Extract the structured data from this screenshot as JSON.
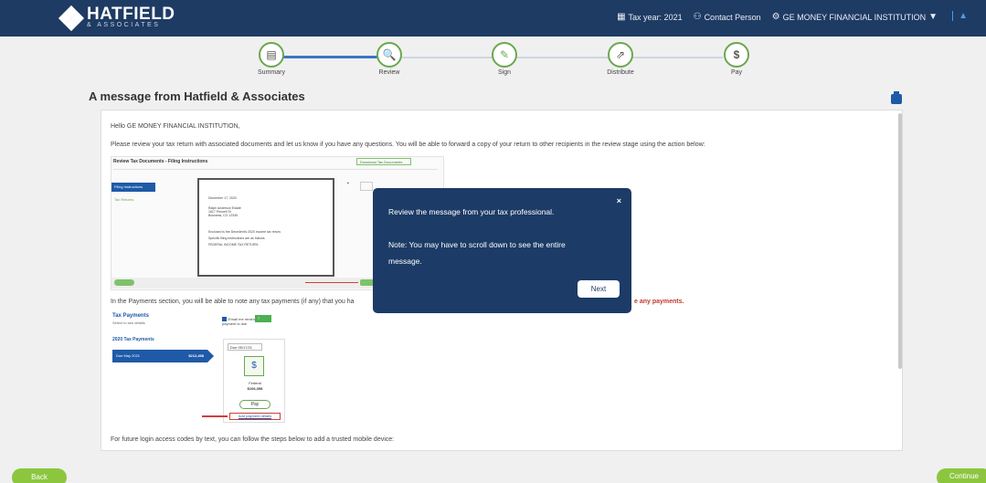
{
  "header": {
    "brand": "HATFIELD",
    "brand_sub": "& ASSOCIATES",
    "tax_year": "Tax year: 2021",
    "contact": "Contact Person",
    "client": "GE MONEY FINANCIAL INSTITUTION"
  },
  "stepper": {
    "steps": [
      {
        "label": "Summary",
        "icon": "document-icon"
      },
      {
        "label": "Review",
        "icon": "magnify-document-icon"
      },
      {
        "label": "Sign",
        "icon": "pen-icon"
      },
      {
        "label": "Distribute",
        "icon": "share-document-icon"
      },
      {
        "label": "Pay",
        "icon": "dollar-icon"
      }
    ]
  },
  "main": {
    "title": "A message from Hatfield & Associates",
    "greeting": "Hello GE MONEY FINANCIAL INSTITUTION,",
    "intro": "Please review your tax return with associated documents and let us know if you have any questions. You will be able to forward a copy of your return to other recipients in the review stage using the action below:",
    "payments_text": "In the Payments section, you will be able to note any tax payments (if any) that you ha",
    "payments_red": "e any payments.",
    "login_text": "For future login access codes by text, you can follow the steps below to add a trusted mobile device:"
  },
  "shot1": {
    "header": "Review Tax Documents - Filing Instructions",
    "download": "Download Tax Documents",
    "side_active": "Filing Instructions",
    "side_other": "Tax Returns",
    "paper_lines": [
      "December 17, 2020",
      "Ralph Anderson Estate",
      "1617 Pennell St",
      "Business, CO 12345",
      "Enclosed is the Decedent's 2020 income tax return.",
      "Specific filing instructions are as follows.",
      "FEDERAL INCOME TAX RETURN:"
    ]
  },
  "shot2": {
    "title": "Tax Payments",
    "subtitle": "Select to see details",
    "year": "2020 Tax Payments",
    "due_label": "Due May 2021",
    "due_amount": "$212,498",
    "email": "Email me reminder",
    "email2": "payment is due",
    "days": "7",
    "due_date": "Due 05/17/21",
    "federal": "Federal",
    "federal_amount": "$106,398",
    "pay": "Pay",
    "add": "Add payment details"
  },
  "modal": {
    "line1": "Review the message from your tax professional.",
    "line2": "Note: You may have to scroll down to see the entire",
    "line3": "message.",
    "next": "Next"
  },
  "footer": {
    "back": "Back",
    "continue": "Continue"
  }
}
